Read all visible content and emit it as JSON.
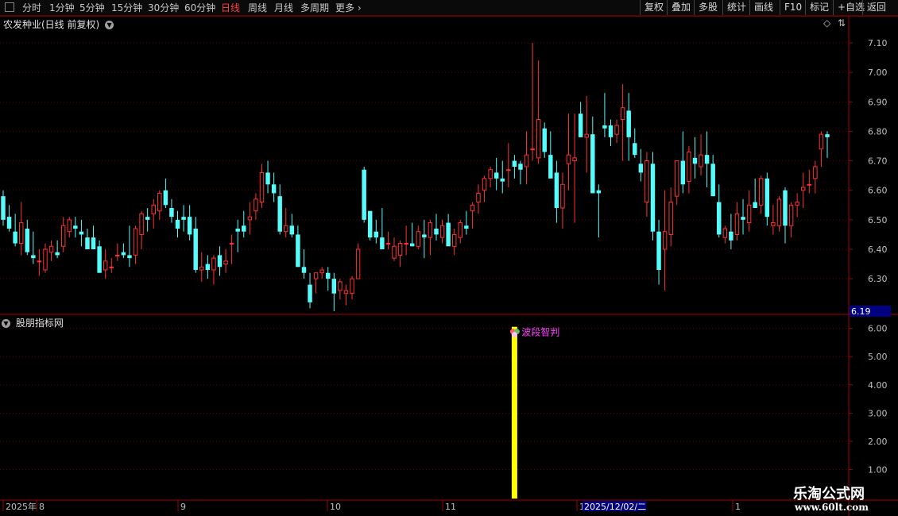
{
  "toolbar": {
    "left_items": [
      {
        "label": "分时",
        "active": false
      },
      {
        "label": "1分钟",
        "active": false
      },
      {
        "label": "5分钟",
        "active": false
      },
      {
        "label": "15分钟",
        "active": false
      },
      {
        "label": "30分钟",
        "active": false
      },
      {
        "label": "60分钟",
        "active": false
      },
      {
        "label": "日线",
        "active": true
      },
      {
        "label": "周线",
        "active": false
      },
      {
        "label": "月线",
        "active": false
      },
      {
        "label": "多周期",
        "active": false
      },
      {
        "label": "更多",
        "active": false
      }
    ],
    "right_items": [
      "复权",
      "叠加",
      "多股",
      "统计",
      "画线",
      "F10",
      "标记",
      "+自选",
      "返回"
    ]
  },
  "main_panel": {
    "title": "农发种业(日线 前复权)",
    "current_price_label": "6.19"
  },
  "indicator_panel": {
    "title": "股朋指标网",
    "signal_label": "波段智判"
  },
  "date_axis": {
    "labels": [
      "2025年",
      "8",
      "9",
      "10",
      "11",
      "1",
      "1"
    ],
    "cursor_date": "2025/12/02/二"
  },
  "watermark": {
    "line1": "乐淘公式网",
    "line2": "www.60lt.com"
  },
  "colors": {
    "up": "#ff3232",
    "down": "#54fcfc",
    "signal_bar": "#ffff00",
    "signal_text": "#ff40ff",
    "grid": "#5a0000",
    "axis_border": "#a00000"
  },
  "chart_data": [
    {
      "type": "candlestick",
      "title": "农发种业(日线 前复权)",
      "y_ticks": [
        6.3,
        6.4,
        6.5,
        6.6,
        6.7,
        6.8,
        6.9,
        7.0,
        7.1
      ],
      "ylim": [
        6.19,
        7.17
      ],
      "x_tick_labels": [
        "8",
        "9",
        "10",
        "11",
        "1",
        "1"
      ],
      "candles": [
        [
          6.58,
          6.6,
          6.48,
          6.5
        ],
        [
          6.51,
          6.55,
          6.46,
          6.47
        ],
        [
          6.46,
          6.52,
          6.41,
          6.42
        ],
        [
          6.42,
          6.56,
          6.38,
          6.49
        ],
        [
          6.47,
          6.5,
          6.38,
          6.39
        ],
        [
          6.38,
          6.46,
          6.35,
          6.37
        ],
        [
          6.36,
          6.4,
          6.31,
          6.36
        ],
        [
          6.33,
          6.42,
          6.32,
          6.4
        ],
        [
          6.39,
          6.43,
          6.36,
          6.41
        ],
        [
          6.39,
          6.43,
          6.37,
          6.38
        ],
        [
          6.41,
          6.51,
          6.39,
          6.48
        ],
        [
          6.46,
          6.51,
          6.44,
          6.5
        ],
        [
          6.48,
          6.51,
          6.44,
          6.47
        ],
        [
          6.46,
          6.5,
          6.41,
          6.45
        ],
        [
          6.44,
          6.47,
          6.41,
          6.4
        ],
        [
          6.44,
          6.48,
          6.4,
          6.4
        ],
        [
          6.41,
          6.43,
          6.32,
          6.32
        ],
        [
          6.33,
          6.4,
          6.3,
          6.36
        ],
        [
          6.34,
          6.37,
          6.32,
          6.34
        ],
        [
          6.38,
          6.42,
          6.36,
          6.38
        ],
        [
          6.39,
          6.42,
          6.37,
          6.38
        ],
        [
          6.38,
          6.48,
          6.34,
          6.37
        ],
        [
          6.38,
          6.48,
          6.35,
          6.47
        ],
        [
          6.45,
          6.53,
          6.4,
          6.52
        ],
        [
          6.51,
          6.54,
          6.46,
          6.5
        ],
        [
          6.52,
          6.57,
          6.47,
          6.55
        ],
        [
          6.53,
          6.6,
          6.5,
          6.59
        ],
        [
          6.6,
          6.64,
          6.54,
          6.55
        ],
        [
          6.54,
          6.57,
          6.49,
          6.51
        ],
        [
          6.5,
          6.53,
          6.44,
          6.47
        ],
        [
          6.51,
          6.55,
          6.46,
          6.5
        ],
        [
          6.51,
          6.55,
          6.43,
          6.45
        ],
        [
          6.47,
          6.51,
          6.32,
          6.33
        ],
        [
          6.33,
          6.39,
          6.29,
          6.34
        ],
        [
          6.35,
          6.38,
          6.3,
          6.33
        ],
        [
          6.33,
          6.38,
          6.28,
          6.37
        ],
        [
          6.38,
          6.41,
          6.31,
          6.34
        ],
        [
          6.35,
          6.4,
          6.32,
          6.36
        ],
        [
          6.42,
          6.45,
          6.35,
          6.42
        ],
        [
          6.47,
          6.5,
          6.39,
          6.46
        ],
        [
          6.48,
          6.53,
          6.44,
          6.46
        ],
        [
          6.5,
          6.56,
          6.45,
          6.51
        ],
        [
          6.53,
          6.59,
          6.5,
          6.57
        ],
        [
          6.56,
          6.69,
          6.54,
          6.66
        ],
        [
          6.66,
          6.7,
          6.59,
          6.62
        ],
        [
          6.62,
          6.66,
          6.56,
          6.59
        ],
        [
          6.58,
          6.62,
          6.45,
          6.46
        ],
        [
          6.46,
          6.54,
          6.44,
          6.48
        ],
        [
          6.48,
          6.52,
          6.44,
          6.45
        ],
        [
          6.45,
          6.48,
          6.34,
          6.34
        ],
        [
          6.34,
          6.4,
          6.3,
          6.32
        ],
        [
          6.28,
          6.32,
          6.2,
          6.22
        ],
        [
          6.3,
          6.32,
          6.25,
          6.32
        ],
        [
          6.32,
          6.34,
          6.3,
          6.33
        ],
        [
          6.32,
          6.34,
          6.26,
          6.3
        ],
        [
          6.3,
          6.32,
          6.19,
          6.25
        ],
        [
          6.26,
          6.3,
          6.23,
          6.29
        ],
        [
          6.25,
          6.28,
          6.21,
          6.26
        ],
        [
          6.25,
          6.31,
          6.23,
          6.3
        ],
        [
          6.3,
          6.42,
          6.3,
          6.4
        ],
        [
          6.67,
          6.68,
          6.49,
          6.5
        ],
        [
          6.53,
          6.53,
          6.43,
          6.44
        ],
        [
          6.46,
          6.5,
          6.42,
          6.44
        ],
        [
          6.44,
          6.54,
          6.41,
          6.4
        ],
        [
          6.42,
          6.46,
          6.4,
          6.42
        ],
        [
          6.37,
          6.44,
          6.36,
          6.41
        ],
        [
          6.38,
          6.43,
          6.34,
          6.42
        ],
        [
          6.42,
          6.48,
          6.38,
          6.42
        ],
        [
          6.42,
          6.49,
          6.41,
          6.41
        ],
        [
          6.41,
          6.48,
          6.4,
          6.46
        ],
        [
          6.45,
          6.5,
          6.37,
          6.44
        ],
        [
          6.44,
          6.5,
          6.38,
          6.49
        ],
        [
          6.47,
          6.52,
          6.43,
          6.45
        ],
        [
          6.44,
          6.5,
          6.42,
          6.48
        ],
        [
          6.49,
          6.52,
          6.43,
          6.41
        ],
        [
          6.41,
          6.47,
          6.38,
          6.45
        ],
        [
          6.44,
          6.5,
          6.42,
          6.49
        ],
        [
          6.48,
          6.53,
          6.45,
          6.47
        ],
        [
          6.53,
          6.56,
          6.47,
          6.55
        ],
        [
          6.56,
          6.62,
          6.52,
          6.59
        ],
        [
          6.6,
          6.65,
          6.56,
          6.64
        ],
        [
          6.64,
          6.68,
          6.61,
          6.67
        ],
        [
          6.66,
          6.71,
          6.6,
          6.64
        ],
        [
          6.64,
          6.7,
          6.59,
          6.63
        ],
        [
          6.67,
          6.76,
          6.61,
          6.67
        ],
        [
          6.7,
          6.72,
          6.64,
          6.68
        ],
        [
          6.69,
          6.7,
          6.62,
          6.67
        ],
        [
          6.68,
          6.8,
          6.62,
          6.72
        ],
        [
          6.74,
          7.1,
          6.7,
          6.74
        ],
        [
          6.71,
          7.04,
          6.69,
          6.84
        ],
        [
          6.81,
          6.83,
          6.71,
          6.73
        ],
        [
          6.72,
          6.8,
          6.7,
          6.64
        ],
        [
          6.66,
          6.7,
          6.49,
          6.54
        ],
        [
          6.54,
          6.66,
          6.47,
          6.62
        ],
        [
          6.69,
          6.86,
          6.6,
          6.72
        ],
        [
          6.7,
          6.86,
          6.49,
          6.71
        ],
        [
          6.86,
          6.9,
          6.8,
          6.78
        ],
        [
          6.78,
          6.92,
          6.66,
          6.79
        ],
        [
          6.79,
          6.85,
          6.6,
          6.59
        ],
        [
          6.6,
          6.62,
          6.44,
          6.59
        ],
        [
          6.82,
          6.93,
          6.78,
          6.81
        ],
        [
          6.82,
          6.84,
          6.75,
          6.78
        ],
        [
          6.79,
          6.84,
          6.76,
          6.82
        ],
        [
          6.84,
          6.96,
          6.7,
          6.88
        ],
        [
          6.87,
          6.93,
          6.7,
          6.78
        ],
        [
          6.76,
          6.81,
          6.71,
          6.72
        ],
        [
          6.69,
          6.74,
          6.63,
          6.66
        ],
        [
          6.56,
          6.73,
          6.51,
          6.7
        ],
        [
          6.69,
          6.73,
          6.43,
          6.46
        ],
        [
          6.46,
          6.5,
          6.28,
          6.33
        ],
        [
          6.4,
          6.6,
          6.26,
          6.46
        ],
        [
          6.45,
          6.61,
          6.41,
          6.56
        ],
        [
          6.58,
          6.68,
          6.55,
          6.7
        ],
        [
          6.7,
          6.8,
          6.59,
          6.62
        ],
        [
          6.63,
          6.75,
          6.59,
          6.73
        ],
        [
          6.71,
          6.78,
          6.64,
          6.69
        ],
        [
          6.68,
          6.79,
          6.65,
          6.72
        ],
        [
          6.72,
          6.8,
          6.61,
          6.69
        ],
        [
          6.69,
          6.72,
          6.58,
          6.58
        ],
        [
          6.56,
          6.62,
          6.44,
          6.45
        ],
        [
          6.44,
          6.48,
          6.42,
          6.47
        ],
        [
          6.46,
          6.52,
          6.4,
          6.43
        ],
        [
          6.45,
          6.56,
          6.43,
          6.52
        ],
        [
          6.51,
          6.57,
          6.45,
          6.5
        ],
        [
          6.49,
          6.6,
          6.46,
          6.55
        ],
        [
          6.56,
          6.64,
          6.54,
          6.54
        ],
        [
          6.55,
          6.65,
          6.52,
          6.64
        ],
        [
          6.64,
          6.66,
          6.48,
          6.51
        ],
        [
          6.48,
          6.55,
          6.45,
          6.49
        ],
        [
          6.48,
          6.58,
          6.46,
          6.57
        ],
        [
          6.6,
          6.61,
          6.42,
          6.48
        ],
        [
          6.48,
          6.56,
          6.44,
          6.55
        ],
        [
          6.55,
          6.59,
          6.51,
          6.56
        ],
        [
          6.6,
          6.66,
          6.54,
          6.61
        ],
        [
          6.62,
          6.67,
          6.59,
          6.62
        ],
        [
          6.64,
          6.7,
          6.59,
          6.68
        ],
        [
          6.74,
          6.8,
          6.68,
          6.79
        ],
        [
          6.79,
          6.8,
          6.71,
          6.78
        ]
      ]
    },
    {
      "type": "bar",
      "title": "股朋指标网",
      "y_ticks": [
        1.0,
        2.0,
        3.0,
        4.0,
        5.0,
        6.0
      ],
      "ylim": [
        0.0,
        6.3
      ],
      "signal_index": 85,
      "signal_value": 6.0
    }
  ]
}
